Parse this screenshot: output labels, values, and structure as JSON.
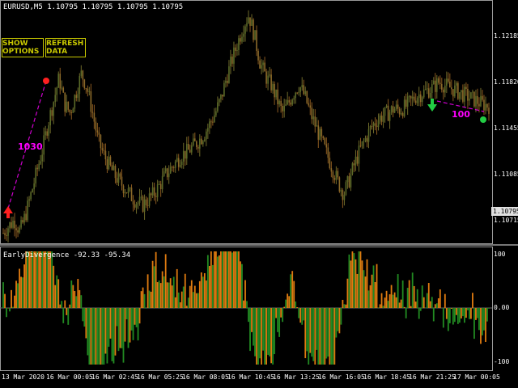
{
  "header": {
    "symbol": "EURUSD,M5",
    "ohlc": "1.10795 1.10795 1.10795 1.10795"
  },
  "buttons": {
    "show_options": "SHOW OPTIONS",
    "refresh_data": "REFRESH DATA"
  },
  "price_axis": {
    "labels": [
      "1.12185",
      "1.11820",
      "1.11455",
      "1.11085",
      "1.10715"
    ],
    "current": "1.10795"
  },
  "divergence_labels": {
    "left": "1030",
    "right": "100"
  },
  "indicator": {
    "title": "EarlyDivergence -92.33 -95.34",
    "axis_labels": [
      "100",
      "0.00",
      "-100"
    ]
  },
  "time_axis": [
    "13 Mar 2020",
    "16 Mar 00:05",
    "16 Mar 02:45",
    "16 Mar 05:25",
    "16 Mar 08:05",
    "16 Mar 10:45",
    "16 Mar 13:25",
    "16 Mar 16:05",
    "16 Mar 18:45",
    "16 Mar 21:25",
    "17 Mar 00:05"
  ],
  "colors": {
    "bull": "#228b22",
    "bear": "#e07b10",
    "candle": "#8b6a2a",
    "buy_arrow": "#ff2020",
    "sell_arrow": "#22cc44",
    "accent": "#ff00ff",
    "button": "#c8c800"
  },
  "chart_data": {
    "type": "line",
    "series": [
      {
        "values": [
          1.1074,
          1.1079,
          1.1083,
          1.1075,
          1.1087,
          1.1102,
          1.1118,
          1.1133,
          1.1152,
          1.1168,
          1.1185,
          1.1166,
          1.116,
          1.1174,
          1.1188,
          1.1178,
          1.116,
          1.114,
          1.113,
          1.1122,
          1.1115,
          1.111,
          1.1105,
          1.11,
          1.1096,
          1.1094,
          1.1098,
          1.1102,
          1.1108,
          1.1115,
          1.112,
          1.1125,
          1.113,
          1.1132,
          1.1136,
          1.114,
          1.1145,
          1.1152,
          1.116,
          1.117,
          1.1185,
          1.1198,
          1.121,
          1.1222,
          1.123,
          1.1215,
          1.1196,
          1.1186,
          1.118,
          1.117,
          1.116,
          1.1166,
          1.1174,
          1.118,
          1.1172,
          1.116,
          1.115,
          1.114,
          1.113,
          1.112,
          1.111,
          1.1102,
          1.1112,
          1.1124,
          1.1134,
          1.1142,
          1.115,
          1.1155,
          1.1158,
          1.116,
          1.1163,
          1.1162,
          1.1164,
          1.1168,
          1.1172,
          1.1174,
          1.1176,
          1.1178,
          1.1182,
          1.118,
          1.1178,
          1.1176,
          1.1174,
          1.1172,
          1.117,
          1.1168,
          1.1166,
          1.1165
        ],
        "low": 1.107,
        "high": 1.1232
      }
    ]
  }
}
